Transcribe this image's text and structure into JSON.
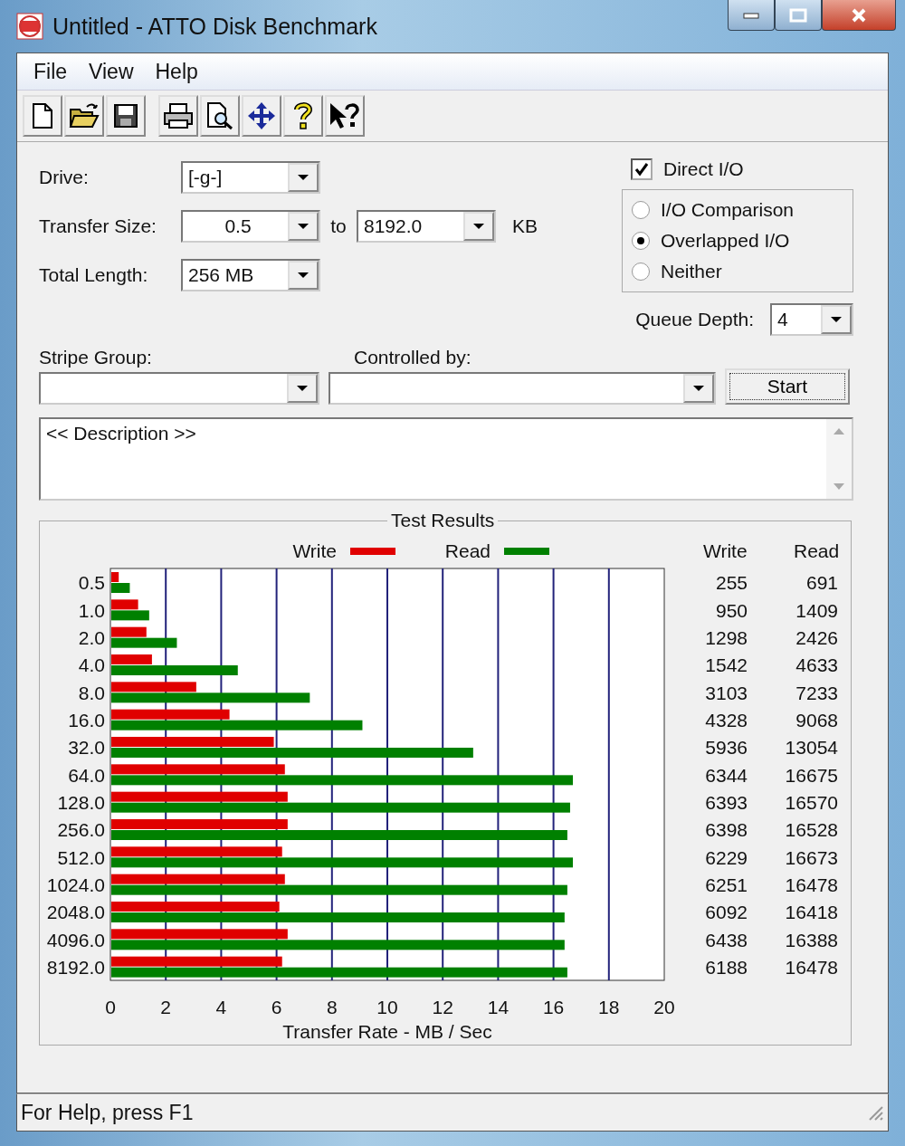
{
  "window": {
    "title": "Untitled - ATTO Disk Benchmark"
  },
  "menu": [
    "File",
    "View",
    "Help"
  ],
  "toolbar": [
    {
      "buttons": [
        {
          "kind": "new"
        },
        {
          "kind": "open"
        },
        {
          "kind": "save"
        }
      ]
    },
    {
      "buttons": [
        {
          "kind": "print"
        },
        {
          "kind": "preview"
        },
        {
          "kind": "move"
        },
        {
          "kind": "help"
        },
        {
          "kind": "context-help"
        }
      ]
    }
  ],
  "form": {
    "drive": {
      "label": "Drive:",
      "value": "[-g-]"
    },
    "transfer_size": {
      "label": "Transfer Size:",
      "from": "0.5",
      "to_label": "to",
      "to": "8192.0",
      "unit": "KB"
    },
    "total_length": {
      "label": "Total Length:",
      "value": "256 MB"
    },
    "direct_io": {
      "label": "Direct I/O",
      "checked": true
    },
    "io_modes": [
      {
        "label": "I/O Comparison",
        "selected": false
      },
      {
        "label": "Overlapped I/O",
        "selected": true
      },
      {
        "label": "Neither",
        "selected": false
      }
    ],
    "queue_depth": {
      "label": "Queue Depth:",
      "value": "4"
    },
    "stripe_group": {
      "label": "Stripe Group:"
    },
    "controlled_by": {
      "label": "Controlled by:"
    },
    "start_button": "Start",
    "description": "<< Description >>"
  },
  "results": {
    "table": {
      "columns": [
        "Write",
        "Read"
      ],
      "rows": [
        [
          "255",
          "691"
        ],
        [
          "950",
          "1409"
        ],
        [
          "1298",
          "2426"
        ],
        [
          "1542",
          "4633"
        ],
        [
          "3103",
          "7233"
        ],
        [
          "4328",
          "9068"
        ],
        [
          "5936",
          "13054"
        ],
        [
          "6344",
          "16675"
        ],
        [
          "6393",
          "16570"
        ],
        [
          "6398",
          "16528"
        ],
        [
          "6229",
          "16673"
        ],
        [
          "6251",
          "16478"
        ],
        [
          "6092",
          "16418"
        ],
        [
          "6438",
          "16388"
        ],
        [
          "6188",
          "16478"
        ]
      ]
    },
    "chart_data": {
      "type": "bar",
      "orientation": "horizontal",
      "title": "Test Results",
      "xlabel": "Transfer Rate - MB / Sec",
      "categories": [
        "0.5",
        "1.0",
        "2.0",
        "4.0",
        "8.0",
        "16.0",
        "32.0",
        "64.0",
        "128.0",
        "256.0",
        "512.0",
        "1024.0",
        "2048.0",
        "4096.0",
        "8192.0"
      ],
      "series": [
        {
          "name": "Write",
          "color": "#e00000",
          "values": [
            0.3,
            1.0,
            1.3,
            1.5,
            3.1,
            4.3,
            5.9,
            6.3,
            6.4,
            6.4,
            6.2,
            6.3,
            6.1,
            6.4,
            6.2
          ]
        },
        {
          "name": "Read",
          "color": "#008000",
          "values": [
            0.7,
            1.4,
            2.4,
            4.6,
            7.2,
            9.1,
            13.1,
            16.7,
            16.6,
            16.5,
            16.7,
            16.5,
            16.4,
            16.4,
            16.5
          ]
        }
      ],
      "xlim": [
        0,
        20
      ],
      "xticks": [
        0,
        2,
        4,
        6,
        8,
        10,
        12,
        14,
        16,
        18,
        20
      ],
      "grid": true,
      "legend": true
    }
  },
  "status_bar": "For Help, press F1"
}
